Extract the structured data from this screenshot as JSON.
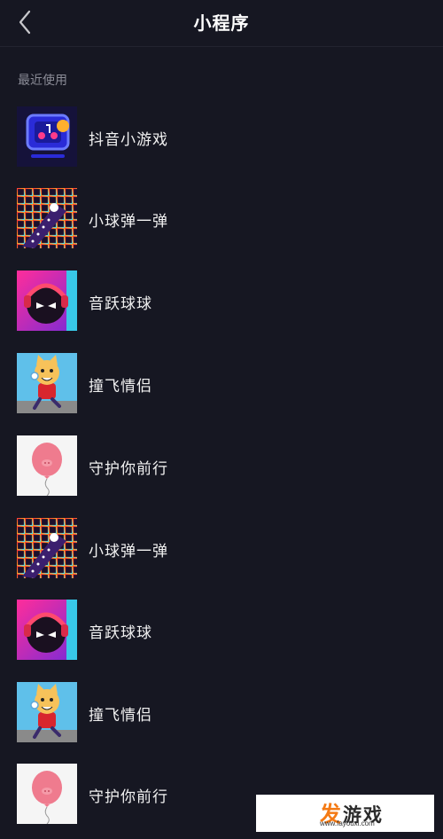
{
  "header": {
    "title": "小程序",
    "back_icon": "chevron-left-icon"
  },
  "section": {
    "label": "最近使用"
  },
  "items": [
    {
      "label": "抖音小游戏",
      "icon": "douyin-games-icon"
    },
    {
      "label": "小球弹一弹",
      "icon": "ball-bounce-icon"
    },
    {
      "label": "音跃球球",
      "icon": "music-ball-icon"
    },
    {
      "label": "撞飞情侣",
      "icon": "cat-runner-icon"
    },
    {
      "label": "守护你前行",
      "icon": "pink-balloon-icon"
    },
    {
      "label": "小球弹一弹",
      "icon": "ball-bounce-icon"
    },
    {
      "label": "音跃球球",
      "icon": "music-ball-icon"
    },
    {
      "label": "撞飞情侣",
      "icon": "cat-runner-icon"
    },
    {
      "label": "守护你前行",
      "icon": "pink-balloon-icon"
    }
  ],
  "watermark": {
    "brand_fa": "发",
    "brand_rest": "游戏",
    "url": "www.fayouxi.com"
  },
  "colors": {
    "background": "#161722",
    "section_text": "#8a8b96"
  }
}
